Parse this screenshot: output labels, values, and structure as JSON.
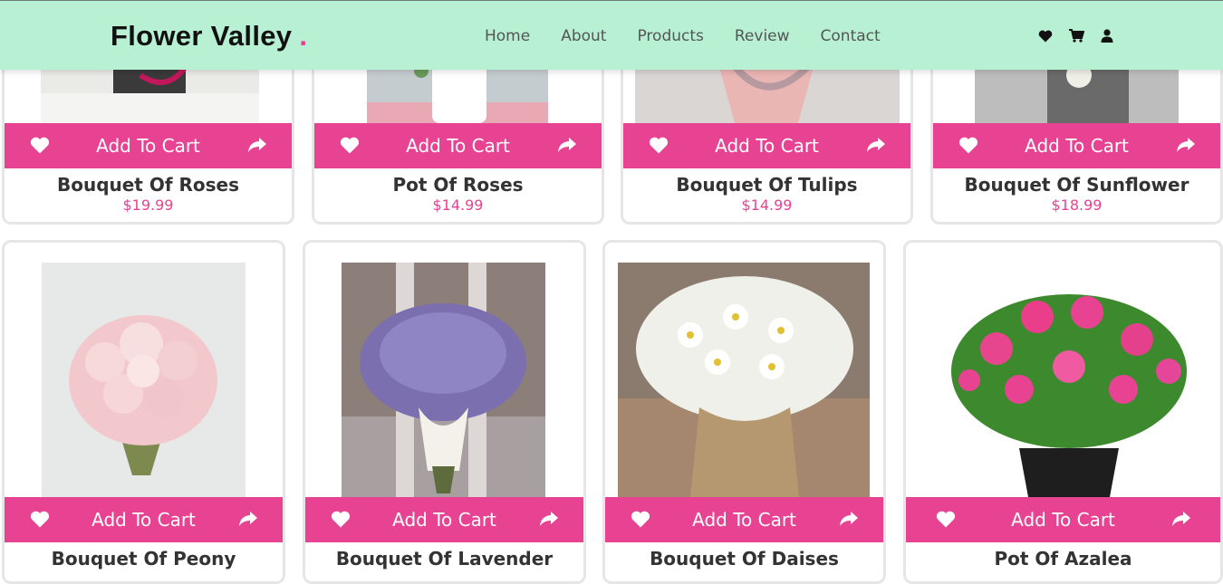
{
  "header": {
    "logo": "Flower Valley",
    "logo_dot": ".",
    "nav": [
      "Home",
      "About",
      "Products",
      "Review",
      "Contact"
    ],
    "icons": [
      "heart-icon",
      "cart-icon",
      "user-icon"
    ]
  },
  "colors": {
    "accent": "#e84393",
    "header_bg": "#b8f0d4"
  },
  "cart_label": "Add To Cart",
  "products_top": [
    {
      "name": "Bouquet Of Roses",
      "price": "$19.99"
    },
    {
      "name": "Pot Of Roses",
      "price": "$14.99"
    },
    {
      "name": "Bouquet Of Tulips",
      "price": "$14.99"
    },
    {
      "name": "Bouquet Of Sunflower",
      "price": "$18.99"
    }
  ],
  "products_bottom": [
    {
      "name": "Bouquet Of Peony"
    },
    {
      "name": "Bouquet Of Lavender"
    },
    {
      "name": "Bouquet Of Daises"
    },
    {
      "name": "Pot Of Azalea"
    }
  ]
}
